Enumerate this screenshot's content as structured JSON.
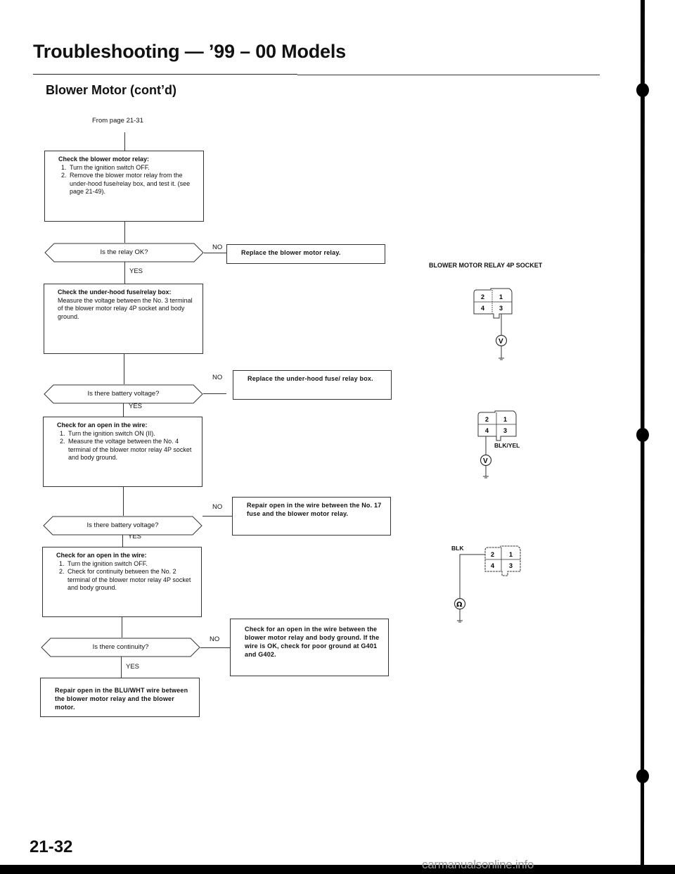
{
  "header": {
    "title": "Troubleshooting — ’99 – 00 Models",
    "subtitle": "Blower Motor (cont’d)",
    "from_page": "From page 21-31"
  },
  "flow": {
    "yes_label": "YES",
    "no_label": "NO",
    "steps": [
      {
        "heading": "Check the blower motor relay:",
        "items": [
          "Turn the ignition switch OFF.",
          "Remove the blower motor relay from the under-hood fuse/relay box, and test it. (see page 21-49)."
        ],
        "question": "Is the relay OK?",
        "no_action": "Replace the blower motor relay."
      },
      {
        "heading": "Check the under-hood fuse/relay box:",
        "body": "Measure the voltage between the No. 3 terminal of the blower motor relay 4P socket and body ground.",
        "question": "Is there battery voltage?",
        "no_action": "Replace the under-hood fuse/ relay box."
      },
      {
        "heading": "Check for an open in the wire:",
        "items": [
          "Turn the ignition switch ON (II).",
          "Measure the voltage between the No. 4 terminal of the blower motor relay 4P socket and body ground."
        ],
        "question": "Is there battery voltage?",
        "no_action": "Repair open in the wire between the No. 17 fuse and the blower motor relay."
      },
      {
        "heading": "Check for an open in the wire:",
        "items": [
          "Turn the ignition switch OFF.",
          "Check for continuity between the No. 2 terminal of the blower motor relay 4P socket and body ground."
        ],
        "question": "Is there continuity?",
        "no_action": "Check for an open in the wire between the blower motor relay and body ground. If the wire is OK, check for poor ground at G401 and G402."
      }
    ],
    "final_action": "Repair open in the BLU/WHT wire between the blower motor relay and the blower motor."
  },
  "diagrams": {
    "title": "BLOWER MOTOR RELAY 4P SOCKET",
    "terminals": [
      "2",
      "1",
      "4",
      "3"
    ],
    "items": [
      {
        "meter_icon": "voltmeter-icon",
        "meter_symbol": "V",
        "terminal": "3",
        "wire": ""
      },
      {
        "meter_icon": "voltmeter-icon",
        "meter_symbol": "V",
        "terminal": "4",
        "wire": "BLK/YEL"
      },
      {
        "meter_icon": "ohmmeter-icon",
        "meter_symbol": "Ω",
        "terminal": "2",
        "wire": "BLK"
      }
    ]
  },
  "footer": {
    "page_number": "21-32",
    "watermark": "carmanualsonline.info"
  }
}
